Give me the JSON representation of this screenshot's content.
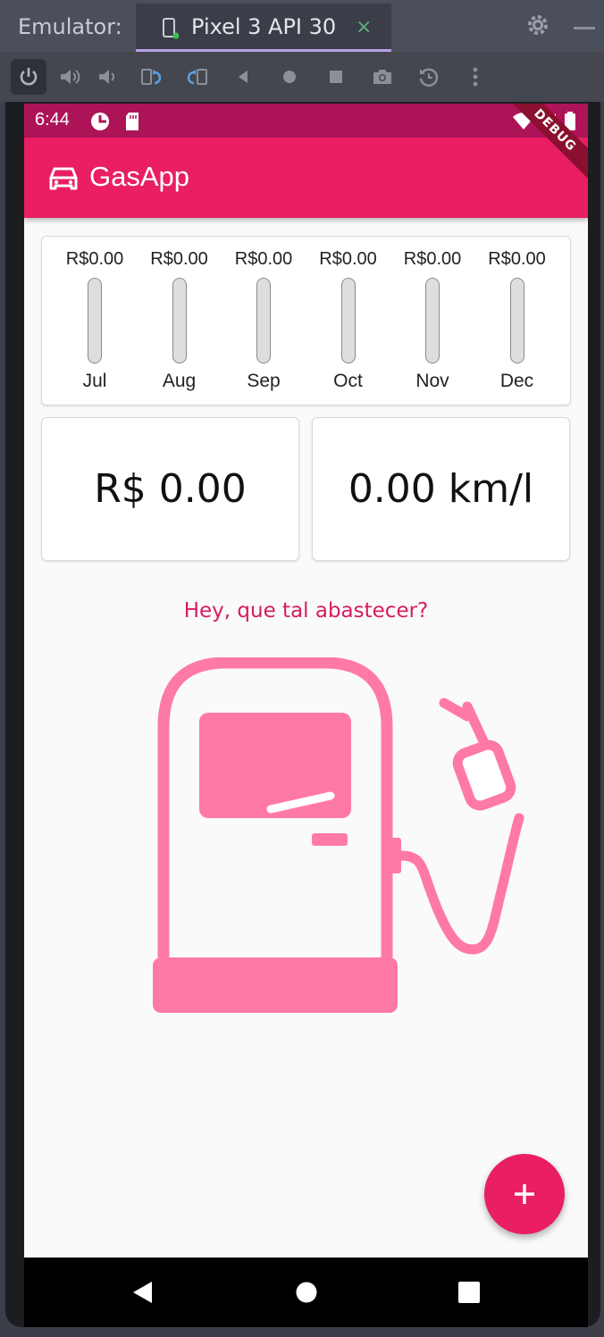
{
  "emulator": {
    "label": "Emulator:",
    "tab_title": "Pixel 3 API 30",
    "tab_close": "×"
  },
  "toolbar": {
    "icons": [
      "power-icon",
      "volume-up-icon",
      "volume-down-icon",
      "rotate-left-icon",
      "rotate-right-icon",
      "back-icon",
      "home-icon",
      "overview-icon",
      "camera-icon",
      "snapshot-icon",
      "more-icon"
    ]
  },
  "status_bar": {
    "time": "6:44"
  },
  "debug_banner": "DEBUG",
  "app_bar": {
    "title": "GasApp"
  },
  "chart_data": {
    "type": "bar",
    "categories": [
      "Jul",
      "Aug",
      "Sep",
      "Oct",
      "Nov",
      "Dec"
    ],
    "value_labels": [
      "R$0.00",
      "R$0.00",
      "R$0.00",
      "R$0.00",
      "R$0.00",
      "R$0.00"
    ],
    "values": [
      0,
      0,
      0,
      0,
      0,
      0
    ]
  },
  "stats": {
    "total": "R$ 0.00",
    "efficiency": "0.00 km/l"
  },
  "prompt": "Hey, que tal abastecer?",
  "fab_label": "+",
  "colors": {
    "primary": "#e91e63",
    "status_bar": "#ad1457",
    "illustration": "#ff79a6"
  }
}
